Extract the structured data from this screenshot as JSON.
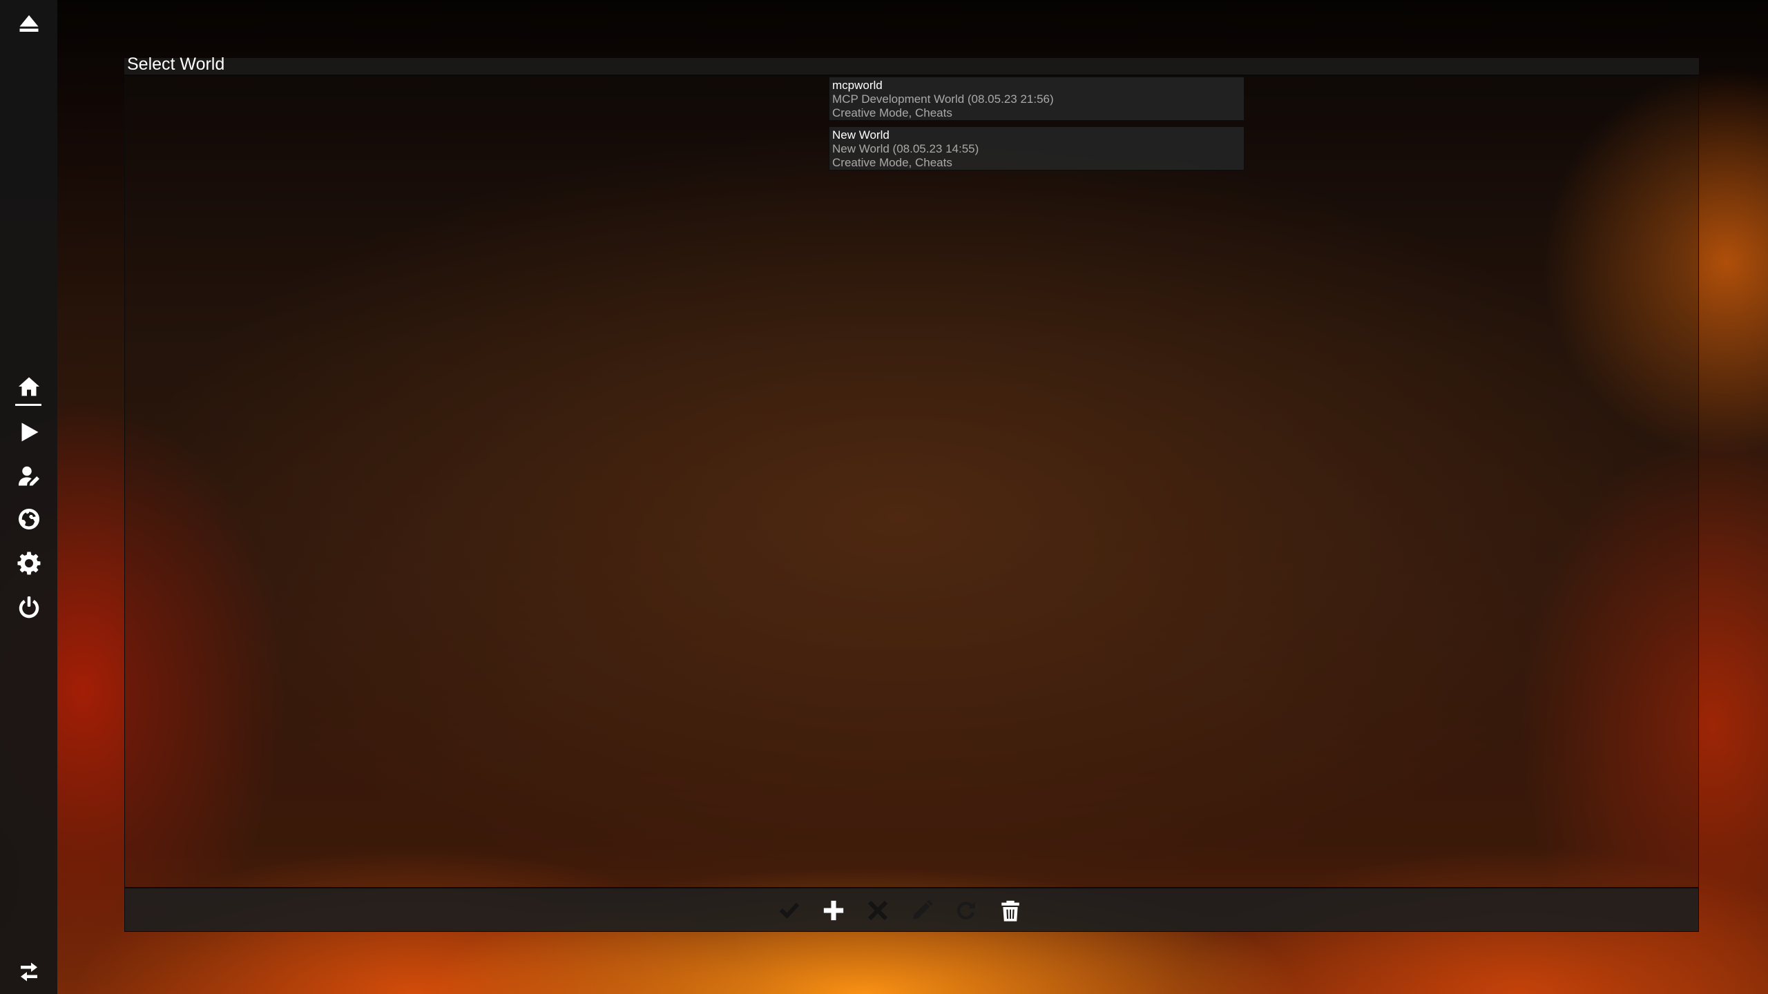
{
  "screen": {
    "title": "Select World"
  },
  "sidebar": {
    "items": [
      {
        "name": "eject-icon"
      },
      {
        "name": "home-icon",
        "active": true
      },
      {
        "name": "play-icon"
      },
      {
        "name": "user-edit-icon"
      },
      {
        "name": "globe-icon"
      },
      {
        "name": "gear-icon"
      },
      {
        "name": "power-icon"
      },
      {
        "name": "swap-arrows-icon"
      }
    ]
  },
  "worlds": [
    {
      "name": "mcpworld",
      "detail": "MCP Development World (08.05.23 21:56)",
      "mode": "Creative Mode, Cheats"
    },
    {
      "name": "New World",
      "detail": "New World (08.05.23 14:55)",
      "mode": "Creative Mode, Cheats"
    }
  ],
  "toolbar": {
    "buttons": [
      {
        "name": "check-icon",
        "enabled": false
      },
      {
        "name": "plus-icon",
        "enabled": true
      },
      {
        "name": "close-icon",
        "enabled": false
      },
      {
        "name": "pencil-icon",
        "enabled": false
      },
      {
        "name": "refresh-icon",
        "enabled": false
      },
      {
        "name": "trash-icon",
        "enabled": true
      }
    ]
  },
  "colors": {
    "sidebar_bg": "#161616",
    "icon_enabled": "#ffffff",
    "icon_disabled": "#141414",
    "item_bg": "#242424",
    "secondary_text": "#a9a9a9"
  }
}
